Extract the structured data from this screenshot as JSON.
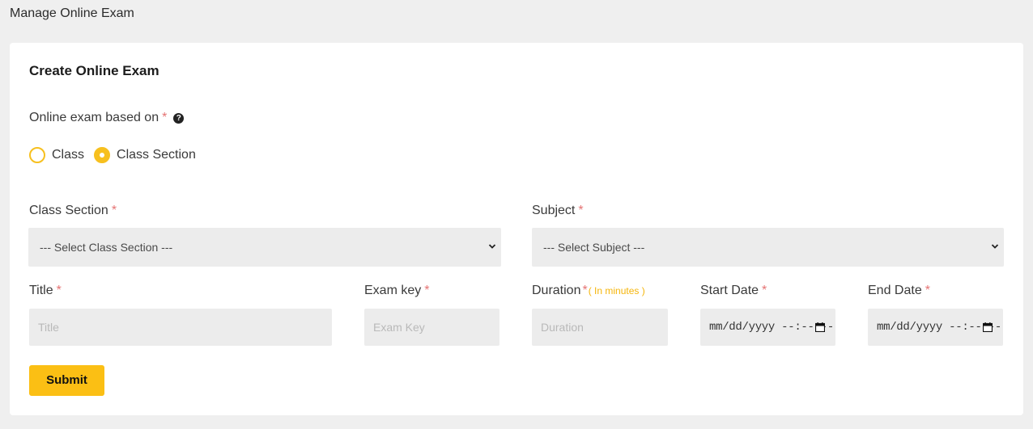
{
  "page": {
    "title": "Manage Online Exam"
  },
  "card": {
    "title": "Create Online Exam"
  },
  "exam_basis": {
    "label": "Online exam based on",
    "required": "*",
    "help_icon": "question-circle-icon",
    "options": [
      {
        "label": "Class",
        "selected": false
      },
      {
        "label": "Class Section",
        "selected": true
      }
    ]
  },
  "fields": {
    "class_section": {
      "label": "Class Section",
      "required": "*",
      "value": "--- Select Class Section ---"
    },
    "subject": {
      "label": "Subject",
      "required": "*",
      "value": "--- Select Subject ---"
    },
    "title": {
      "label": "Title",
      "required": "*",
      "placeholder": "Title"
    },
    "exam_key": {
      "label": "Exam key",
      "required": "*",
      "placeholder": "Exam Key"
    },
    "duration": {
      "label": "Duration",
      "required": "*",
      "hint": "( In minutes )",
      "placeholder": "Duration"
    },
    "start_date": {
      "label": "Start Date",
      "required": "*",
      "value": "mm/dd/yyyy --:-- --"
    },
    "end_date": {
      "label": "End Date",
      "required": "*",
      "value": "mm/dd/yyyy --:-- --"
    }
  },
  "submit": {
    "label": "Submit"
  },
  "colors": {
    "accent": "#fbbf14",
    "required": "#e57373",
    "field_bg": "#ececec"
  }
}
